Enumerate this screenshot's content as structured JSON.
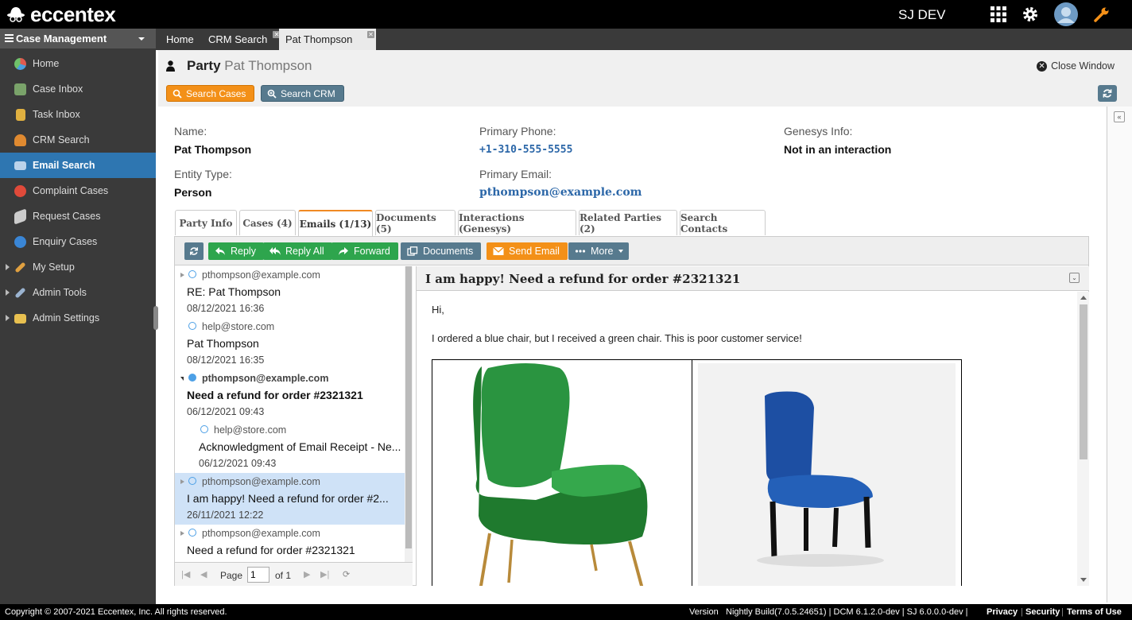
{
  "app": {
    "logo_text": "eccentex",
    "user": "SJ DEV"
  },
  "sidebar": {
    "title": "Case Management",
    "items": [
      {
        "label": "Home",
        "icon": "pie-chart-icon",
        "color": "#e05a4f"
      },
      {
        "label": "Case Inbox",
        "icon": "basket-icon",
        "color": "#7aa36a"
      },
      {
        "label": "Task Inbox",
        "icon": "clipboard-icon",
        "color": "#e0b040"
      },
      {
        "label": "CRM Search",
        "icon": "users-search-icon",
        "color": "#e08a30"
      },
      {
        "label": "Email Search",
        "icon": "envelope-icon",
        "color": "#bcd3ea"
      },
      {
        "label": "Complaint Cases",
        "icon": "alert-icon",
        "color": "#e04a3a"
      },
      {
        "label": "Request Cases",
        "icon": "megaphone-icon",
        "color": "#cccccc"
      },
      {
        "label": "Enquiry Cases",
        "icon": "info-icon",
        "color": "#3a86d6"
      },
      {
        "label": "My Setup",
        "icon": "wrench-icon",
        "color": "#e0a040"
      },
      {
        "label": "Admin Tools",
        "icon": "tools-icon",
        "color": "#9ab3d0"
      },
      {
        "label": "Admin Settings",
        "icon": "folder-icon",
        "color": "#e8c050"
      }
    ]
  },
  "window_tabs": [
    {
      "label": "Home"
    },
    {
      "label": "CRM Search"
    },
    {
      "label": "Pat Thompson"
    }
  ],
  "page": {
    "title": "Party",
    "subtitle": "Pat Thompson",
    "close_label": "Close Window"
  },
  "toolbar": {
    "search_cases": "Search Cases",
    "search_crm": "Search CRM"
  },
  "party": {
    "name_label": "Name:",
    "name": "Pat Thompson",
    "entity_label": "Entity Type:",
    "entity": "Person",
    "phone_label": "Primary Phone:",
    "phone": "+1-310-555-5555",
    "email_label": "Primary Email:",
    "email": "pthompson@example.com",
    "genesys_label": "Genesys Info:",
    "genesys": "Not in an interaction"
  },
  "party_tabs": [
    "Party Info",
    "Cases (4)",
    "Emails (1/13)",
    "Documents (5)",
    "Interactions (Genesys)",
    "Related Parties (2)",
    "Search Contacts"
  ],
  "email_toolbar": {
    "reply": "Reply",
    "reply_all": "Reply All",
    "forward": "Forward",
    "documents": "Documents",
    "send_email": "Send Email",
    "more": "More"
  },
  "emails": [
    {
      "from": "pthompson@example.com",
      "subject": "RE: Pat Thompson",
      "date": "08/12/2021 16:36"
    },
    {
      "from": "help@store.com",
      "subject": "Pat Thompson",
      "date": "08/12/2021 16:35"
    },
    {
      "from": "pthompson@example.com",
      "subject": "Need a refund for order #2321321",
      "date": "06/12/2021 09:43"
    },
    {
      "from": "help@store.com",
      "subject": "Acknowledgment of Email Receipt - Ne...",
      "date": "06/12/2021 09:43"
    },
    {
      "from": "pthompson@example.com",
      "subject": "I am happy! Need a refund for order #2...",
      "date": "26/11/2021 12:22"
    },
    {
      "from": "pthompson@example.com",
      "subject": "Need a refund for order #2321321",
      "date": ""
    }
  ],
  "pager": {
    "page_label": "Page",
    "page_value": "1",
    "of_label": "of 1"
  },
  "reading": {
    "subject": "I am happy! Need a refund for order #2321321",
    "greeting": "Hi,",
    "body": "I ordered a blue chair, but I received a green chair. This is poor customer service!"
  },
  "footer": {
    "copyright": "Copyright © 2007-2021 Eccentex, Inc. All rights reserved.",
    "version_label": "Version",
    "version": "Nightly Build(7.0.5.24651) | DCM 6.1.2.0-dev | SJ 6.0.0.0-dev |",
    "privacy": "Privacy",
    "security": "Security",
    "terms": "Terms of Use"
  },
  "colors": {
    "accent_orange": "#f39018",
    "slate": "#577a8e",
    "green": "#2ea54d",
    "sidebar_active": "#2e76b1"
  }
}
